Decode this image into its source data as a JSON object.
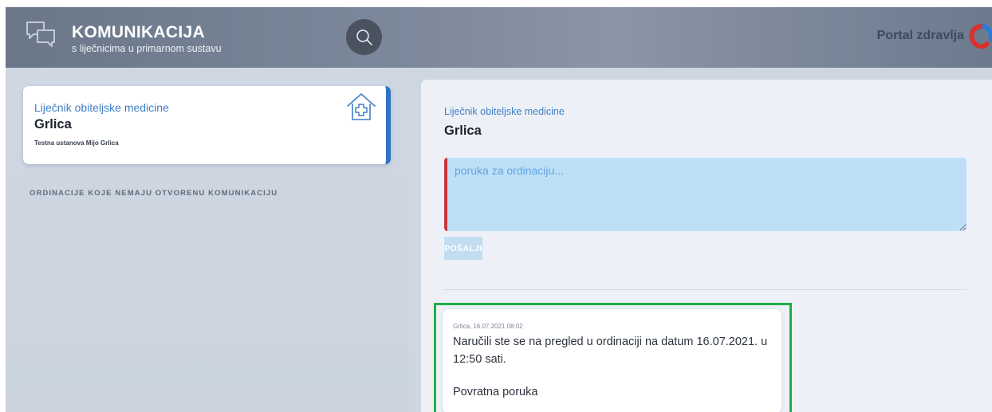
{
  "header": {
    "title": "KOMUNIKACIJA",
    "subtitle": "s liječnicima u primarnom sustavu",
    "brand_icon": "chat-bubbles-icon",
    "search_icon": "search-icon",
    "portal_label": "Portal zdravlja",
    "portal_logo": "portal-zdravlja-logo"
  },
  "sidebar": {
    "active_doctor": {
      "kicker": "Liječnik obiteljske medicine",
      "name": "Grlica",
      "institution": "Testna ustanova Mijo Grlica",
      "icon": "medical-house-icon",
      "accent_color": "#2f72c4"
    },
    "section_title": "ORDINACIJE KOJE NEMAJU OTVORENU KOMUNIKACIJU"
  },
  "conversation": {
    "kicker": "Liječnik obiteljske medicine",
    "name": "Grlica",
    "input": {
      "placeholder": "poruka za ordinaciju...",
      "value": ""
    },
    "send_label": "POŠALJI",
    "messages": [
      {
        "meta": "Grlica, 16.07.2021 08:02",
        "text": "Naručili ste se na pregled u ordinaciji na datum 16.07.2021. u 12:50 sati.",
        "reply": "Povratna poruka"
      }
    ]
  },
  "colors": {
    "accent": "#3f7fc4",
    "input_border": "#c7373d",
    "highlight_frame": "#22ad46"
  }
}
